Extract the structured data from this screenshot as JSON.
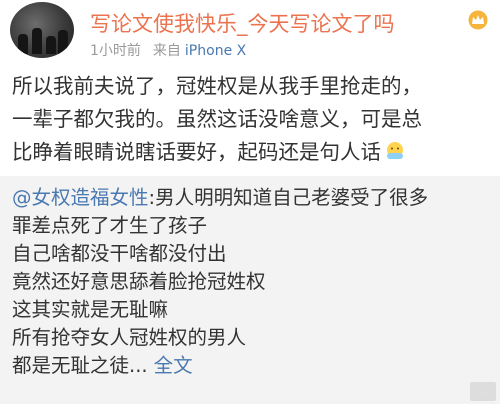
{
  "post": {
    "username": "写论文使我快乐_今天写论文了吗",
    "time": "1小时前",
    "source_prefix": "来自",
    "device": "iPhone X",
    "lines": [
      "所以我前夫说了，冠姓权是从我手里抢走的，",
      "一辈子都欠我的。虽然这话没啥意义，可是总",
      "比睁着眼睛说瞎话要好，起码还是句人话"
    ],
    "crown_icon": "vip-crown-icon",
    "emoji_icon": "emoji-hand-icon"
  },
  "repost": {
    "mention": "@女权造福女性",
    "first_line_rest": ":男人明明知道自己老婆受了很多",
    "lines": [
      "罪差点死了才生了孩子",
      "自己啥都没干啥都没付出",
      "竟然还好意思舔着脸抢冠姓权",
      "这其实就是无耻嘛",
      "所有抢夺女人冠姓权的男人"
    ],
    "last_line": "都是无耻之徒...",
    "more_label": "全文",
    "watermark": "..."
  },
  "colors": {
    "username": "#eb7350",
    "link": "#4a78b0",
    "meta": "#9a9a9a",
    "repost_bg": "#f3f3f3"
  }
}
